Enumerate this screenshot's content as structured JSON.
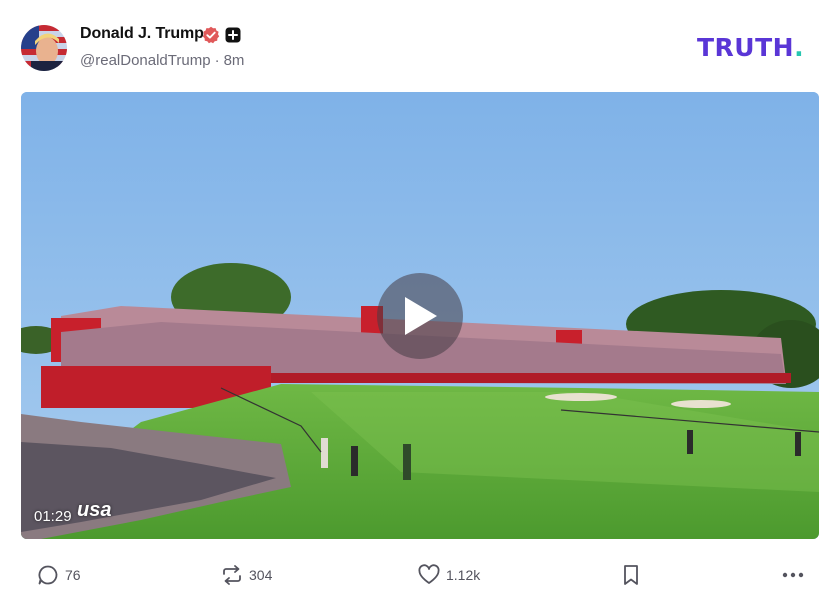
{
  "post": {
    "author": {
      "display_name": "Donald J. Trump",
      "handle": "@realDonaldTrump",
      "separator": "·",
      "time_ago": "8m",
      "avatar_icon": "flag-portrait-avatar",
      "verified_icon": "verified-badge-icon",
      "verified_color": "#e0595a"
    },
    "brand": {
      "logo_text": "TRUTH",
      "logo_dot": ".",
      "logo_color": "#5a36d6",
      "logo_dot_color": "#26c6b0"
    },
    "video": {
      "duration": "01:29",
      "network_label": "usa",
      "play_icon": "play-icon"
    },
    "actions": {
      "replies": "76",
      "retruths": "304",
      "likes": "1.12k"
    }
  }
}
